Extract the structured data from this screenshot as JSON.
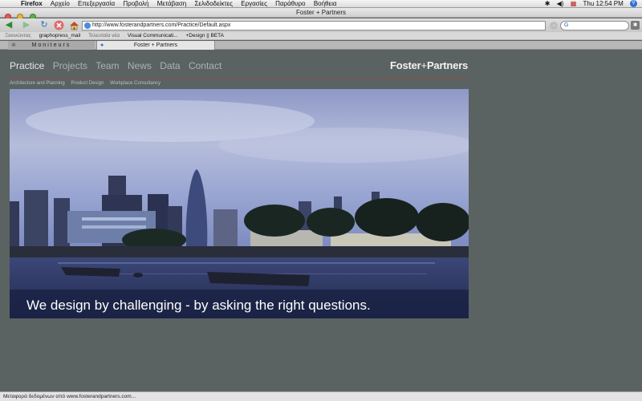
{
  "menubar": {
    "app": "Firefox",
    "items": [
      "Αρχείο",
      "Επεξεργασία",
      "Προβολή",
      "Μετάβαση",
      "Σελιδοδείκτες",
      "Εργασίες",
      "Παράθυρο",
      "Βοήθεια"
    ],
    "clock": "Thu 12:54 PM"
  },
  "window": {
    "title": "Foster + Partners"
  },
  "toolbar": {
    "url": "http://www.fosterandpartners.com/Practice/Default.aspx",
    "search_value": "G"
  },
  "bookmarks": {
    "items": [
      "Ξεκινώντας",
      "graphopress_mail",
      "Τελευταία νέα",
      "Visual Communicati...",
      "+Design || BETA"
    ]
  },
  "tabs": [
    {
      "label": "Moniteurs"
    },
    {
      "label": "Foster + Partners"
    }
  ],
  "site": {
    "logo_left": "Foster",
    "logo_plus": "+",
    "logo_right": "Partners",
    "nav": [
      "Practice",
      "Projects",
      "Team",
      "News",
      "Data",
      "Contact"
    ],
    "subnav": [
      "Architecture and Planning",
      "Product Design",
      "Workplace Consultancy"
    ],
    "hero_caption": "We design by challenging - by asking the right questions."
  },
  "status": {
    "text": "Μεταφορά δεδομένων από www.fosterandpartners.com..."
  },
  "colors": {
    "page_bg": "#5b6262",
    "accent_rule": "#8a4f4c",
    "caption_bg": "#182142"
  },
  "icons": [
    "apple-icon",
    "back-arrow-icon",
    "forward-arrow-icon",
    "reload-icon",
    "stop-icon",
    "home-icon",
    "globe-icon",
    "go-icon",
    "google-icon",
    "throbber-icon",
    "spotlight-icon"
  ]
}
